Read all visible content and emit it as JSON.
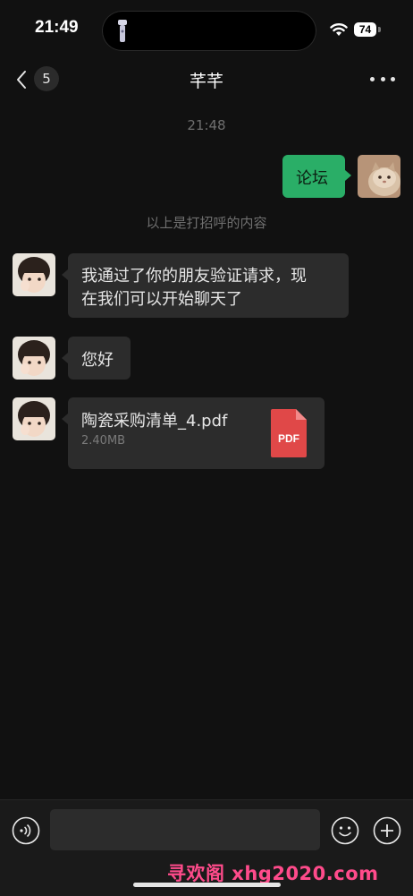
{
  "status_bar": {
    "time": "21:49",
    "battery": "74"
  },
  "nav": {
    "unread_count": "5",
    "title": "芊芊"
  },
  "conversation": {
    "timestamp": "21:48",
    "outgoing_message": "论坛",
    "system_notice": "以上是打招呼的内容",
    "incoming_messages": [
      {
        "text_line1": "我通过了你的朋友验证请求，现",
        "text_line2": "在我们可以开始聊天了"
      },
      {
        "text": "您好"
      }
    ],
    "file": {
      "name": "陶瓷采购清单_4.pdf",
      "size": "2.40MB",
      "type_label": "PDF",
      "icon_color": "#e04848"
    }
  },
  "input_bar": {
    "placeholder": "",
    "value": ""
  },
  "watermark": "寻欢阁 xhg2020.com",
  "colors": {
    "accent_green": "#2aae67",
    "bubble_dark": "#2c2c2c",
    "background": "#111111"
  }
}
